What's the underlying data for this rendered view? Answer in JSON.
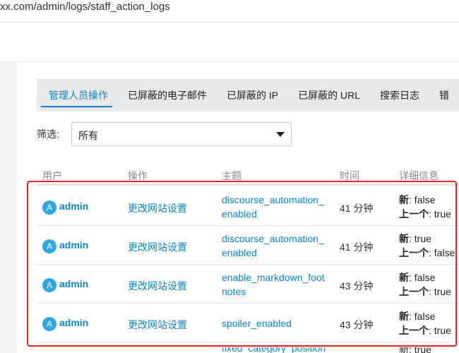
{
  "browser": {
    "url": "xx.com/admin/logs/staff_action_logs"
  },
  "tabs": [
    {
      "label": "管理人员操作",
      "active": true
    },
    {
      "label": "已屏蔽的电子邮件",
      "active": false
    },
    {
      "label": "已屏蔽的 IP",
      "active": false
    },
    {
      "label": "已屏蔽的 URL",
      "active": false
    },
    {
      "label": "搜索日志",
      "active": false
    },
    {
      "label": "错",
      "active": false
    }
  ],
  "filter": {
    "label": "筛选:",
    "selected": "所有"
  },
  "table": {
    "headers": {
      "user": "用户",
      "action": "操作",
      "subject": "主题",
      "time": "时间",
      "details": "详细信息"
    },
    "rows": [
      {
        "avatar": "A",
        "user": "admin",
        "action": "更改网站设置",
        "subject_lines": [
          "discourse_automation_",
          "enabled"
        ],
        "time": "41 分钟",
        "new_label": "新",
        "new_value": ": false",
        "prev_label": "上一个",
        "prev_value": ": true"
      },
      {
        "avatar": "A",
        "user": "admin",
        "action": "更改网站设置",
        "subject_lines": [
          "discourse_automation_",
          "enabled"
        ],
        "time": "41 分钟",
        "new_label": "新",
        "new_value": ": true",
        "prev_label": "上一个",
        "prev_value": ": false"
      },
      {
        "avatar": "A",
        "user": "admin",
        "action": "更改网站设置",
        "subject_lines": [
          "enable_markdown_foot",
          "notes"
        ],
        "time": "43 分钟",
        "new_label": "新",
        "new_value": ": false",
        "prev_label": "上一个",
        "prev_value": ": true"
      },
      {
        "avatar": "A",
        "user": "admin",
        "action": "更改网站设置",
        "subject_lines": [
          "spoiler_enabled"
        ],
        "time": "43 分钟",
        "new_label": "新",
        "new_value": ": false",
        "prev_label": "上一个",
        "prev_value": ": true"
      }
    ],
    "peek": {
      "subject": "fixed_category_position",
      "details": "新: true"
    }
  },
  "colors": {
    "link": "#0a86c8",
    "avatar": "#2ea8e0",
    "highlight": "#ee2222",
    "tabs_bg": "#e9e9e9"
  },
  "icons": {
    "select_caret": "caret-down-icon"
  }
}
